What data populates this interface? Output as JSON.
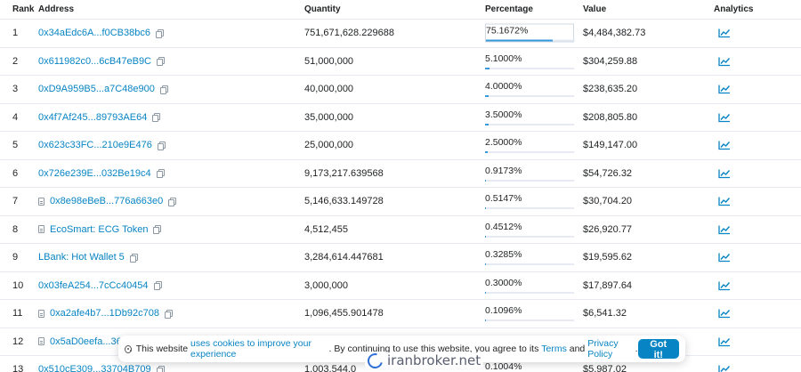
{
  "header": {
    "rank": "Rank",
    "address": "Address",
    "quantity": "Quantity",
    "percentage": "Percentage",
    "value": "Value",
    "analytics": "Analytics"
  },
  "rows": [
    {
      "rank": "1",
      "address": "0x34aEdc6A...f0CB38bc6",
      "is_contract": false,
      "quantity": "751,671,628.229688",
      "percentage": "75.1672%",
      "pct": 0.751672,
      "value": "$4,484,382.73"
    },
    {
      "rank": "2",
      "address": "0x611982c0...6cB47eB9C",
      "is_contract": false,
      "quantity": "51,000,000",
      "percentage": "5.1000%",
      "pct": 0.051,
      "value": "$304,259.88"
    },
    {
      "rank": "3",
      "address": "0xD9A959B5...a7C48e900",
      "is_contract": false,
      "quantity": "40,000,000",
      "percentage": "4.0000%",
      "pct": 0.04,
      "value": "$238,635.20"
    },
    {
      "rank": "4",
      "address": "0x4f7Af245...89793AE64",
      "is_contract": false,
      "quantity": "35,000,000",
      "percentage": "3.5000%",
      "pct": 0.035,
      "value": "$208,805.80"
    },
    {
      "rank": "5",
      "address": "0x623c33FC...210e9E476",
      "is_contract": false,
      "quantity": "25,000,000",
      "percentage": "2.5000%",
      "pct": 0.025,
      "value": "$149,147.00"
    },
    {
      "rank": "6",
      "address": "0x726e239E...032Be19c4",
      "is_contract": false,
      "quantity": "9,173,217.639568",
      "percentage": "0.9173%",
      "pct": 0.009173,
      "value": "$54,726.32"
    },
    {
      "rank": "7",
      "address": "0x8e98eBeB...776a663e0",
      "is_contract": true,
      "quantity": "5,146,633.149728",
      "percentage": "0.5147%",
      "pct": 0.005147,
      "value": "$30,704.20"
    },
    {
      "rank": "8",
      "address": "EcoSmart: ECG Token",
      "is_contract": true,
      "quantity": "4,512,455",
      "percentage": "0.4512%",
      "pct": 0.004512,
      "value": "$26,920.77"
    },
    {
      "rank": "9",
      "address": "LBank: Hot Wallet 5",
      "is_contract": false,
      "quantity": "3,284,614.447681",
      "percentage": "0.3285%",
      "pct": 0.003285,
      "value": "$19,595.62"
    },
    {
      "rank": "10",
      "address": "0x03feA254...7cCc40454",
      "is_contract": false,
      "quantity": "3,000,000",
      "percentage": "0.3000%",
      "pct": 0.003,
      "value": "$17,897.64"
    },
    {
      "rank": "11",
      "address": "0xa2afe4b7...1Db92c708",
      "is_contract": true,
      "quantity": "1,096,455.901478",
      "percentage": "0.1096%",
      "pct": 0.001096,
      "value": "$6,541.32"
    },
    {
      "rank": "12",
      "address": "0x5aD0eefa...3675",
      "is_contract": true,
      "quantity": "",
      "percentage": "",
      "pct": 0.0,
      "value": ""
    },
    {
      "rank": "13",
      "address": "0x510cE309...33704B709",
      "is_contract": false,
      "quantity": "1,003,544.0",
      "percentage": "0.1004%",
      "pct": 0.001004,
      "value": "$5,987.02"
    }
  ],
  "cookie_banner": {
    "text_before": "This website ",
    "link_cookies": "uses cookies to improve your experience",
    "text_middle": ". By continuing to use this website, you agree to its ",
    "link_terms": "Terms",
    "text_and": " and ",
    "link_privacy": "Privacy Policy",
    "text_end": ".",
    "button": "Got it!"
  },
  "watermark": "iranbroker.net",
  "colors": {
    "link": "#0784c3",
    "bar": "#3498db",
    "border": "#e7eaf3"
  },
  "icons": {
    "copy": "copy-icon",
    "contract": "document-icon",
    "analytics": "line-chart-icon",
    "cookie": "cookie-icon"
  }
}
